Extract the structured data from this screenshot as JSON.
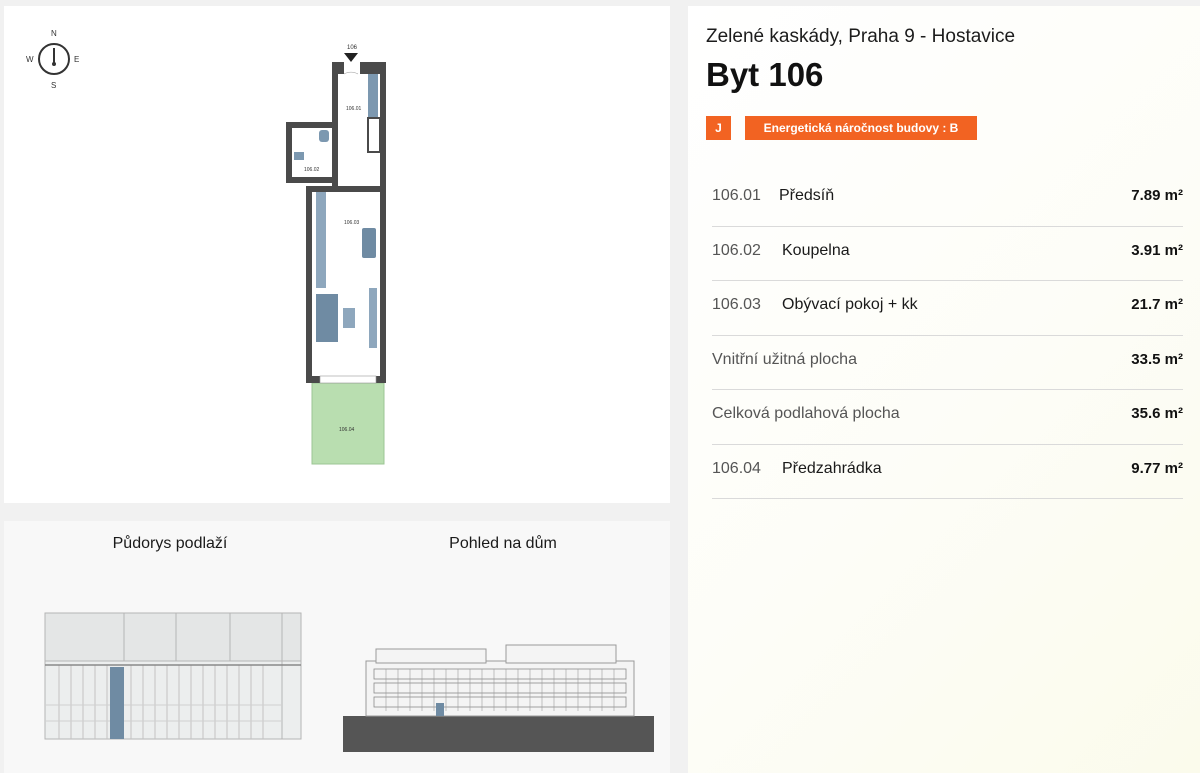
{
  "header": {
    "project": "Zelené kaskády, Praha 9 - Hostavice",
    "unit": "Byt 106"
  },
  "badges": {
    "orientation": "J",
    "energy": "Energetická náročnost budovy : B"
  },
  "rooms": [
    {
      "num": "106.01",
      "name": "Předsíň",
      "area": "7.89 m²"
    },
    {
      "num": "106.02",
      "name": "Koupelna",
      "area": "3.91 m²"
    },
    {
      "num": "106.03",
      "name": "Obývací pokoj + kk",
      "area": "21.7 m²"
    }
  ],
  "summary": [
    {
      "label": "Vnitřní užitná plocha",
      "area": "33.5 m²"
    },
    {
      "label": "Celková podlahová plocha",
      "area": "35.6 m²"
    }
  ],
  "garden": {
    "num": "106.04",
    "name": "Předzahrádka",
    "area": "9.77 m²"
  },
  "plan": {
    "compass": {
      "n": "N",
      "s": "S",
      "e": "E",
      "w": "W"
    },
    "entry_label": "106",
    "room_labels": {
      "r1": "106.01",
      "r2": "106.02",
      "r3": "106.03",
      "r4": "106.04"
    }
  },
  "floor_plan_title": "Půdorys podlaží",
  "house_view_title": "Pohled na dům",
  "colors": {
    "accent": "#f26322",
    "garden": "#b9deb0",
    "highlight": "#6f8ba3",
    "wall": "#4a4a4a"
  }
}
